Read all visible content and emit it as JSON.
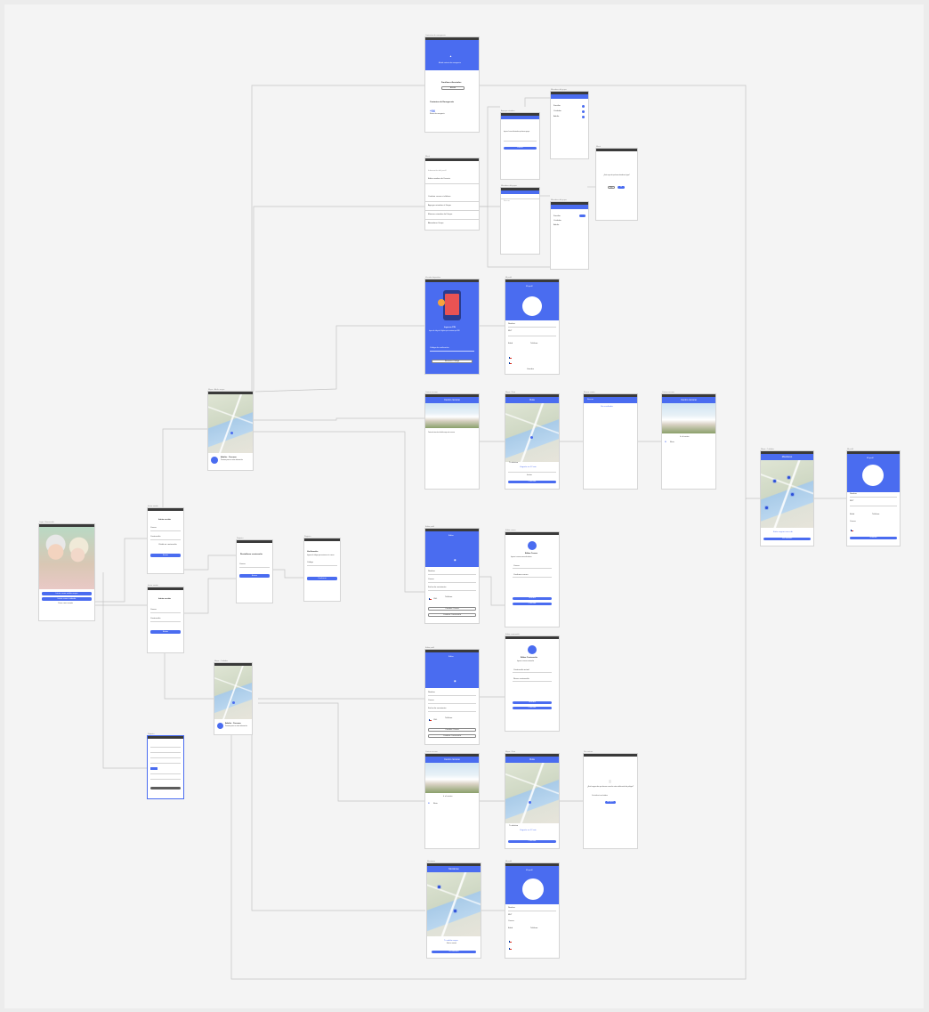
{
  "canvas": {
    "background": "#f4f4f4",
    "accent": "#4a6cf0",
    "wire_color": "#c2c2c2"
  },
  "screen_captions": {
    "welcome": "Login - Bienvenida",
    "login_a": "Iniciar sesión",
    "login_b": "Iniciar sesión",
    "register": "Registro",
    "map_home_a": "Mapa - Adulto mayor",
    "map_home_b": "Mapa - Cuidador",
    "contacts": "Contactos de emergencia",
    "menu": "Menú",
    "pair_device": "Vincular dispositivo",
    "profile_top": "Mi perfil",
    "center_top": "Centro cercano",
    "nav_map": "Mapa - Ruta",
    "search": "Buscar centro",
    "center_b": "Centro cercano",
    "right_map": "Mapa - Cuidador",
    "right_profile": "Mi perfil",
    "profile_edit_a": "Editar perfil",
    "email_screen": "Editar correo",
    "profile_edit_b": "Editar perfil",
    "pass_screen": "Editar contraseña",
    "center_c": "Centro cercano",
    "nav_map_b": "Mapa - Ruta",
    "empty_state": "Sin centros",
    "track_map": "Monitoreo",
    "track_profile": "Mi perfil"
  },
  "welcome": {
    "btn_primary": "Iniciar como adulto mayor",
    "btn_secondary": "Iniciar como cuidador",
    "footer": "Crear una cuenta"
  },
  "login": {
    "title": "Iniciar sesión",
    "field_user": "Correo",
    "field_pass": "Contraseña",
    "forgot": "Olvidé mi contraseña",
    "button": "Entrar"
  },
  "register": {
    "title": "Restablecer contraseña",
    "field": "Correo",
    "button": "Enviar"
  },
  "verify": {
    "title": "Verificación",
    "body": "Ingresa el código que enviamos a tu correo",
    "field": "Código",
    "button": "Confirmar"
  },
  "top_home": {
    "banner": "Añadir contacto de emergencia",
    "section_a": "Familiares Asociados",
    "section_b": "Contactos de Emergencia",
    "add_btn": "Añadir",
    "counter": "+56",
    "counter_sub": "Número de emergencia"
  },
  "menu_screen": {
    "section_a": "Información del perfil",
    "items": [
      "Editar nombre de Usuario",
      "Cambiar correo o teléfono",
      "Agregar miembro al Grupo",
      "Eliminar miembro del Grupo",
      "Abandonar Grupo"
    ]
  },
  "settings_cards": {
    "a_title": "Agregar miembro",
    "a_body": "Ingresa el correo del miembro que deseas agregar",
    "a_button": "Enviar",
    "b_title": "Miembros del grupo",
    "b_items": [
      "Familiar",
      "Cuidador",
      "Adulto"
    ],
    "dialog_title": "¿Estás seguro de que deseas abandonar el grupo?",
    "dialog_yes": "Sí",
    "dialog_no": "No"
  },
  "sms": {
    "title": "Ingresar PIN",
    "body": "Ingresa el código de 4 dígitos que te enviamos por SMS",
    "field": "Código de verificación",
    "button": "Reenviar Código"
  },
  "profile": {
    "header": "Mi perfil",
    "name_label": "Nombre",
    "rut_label": "RUT",
    "age_label": "Edad",
    "phone_label": "Teléfono",
    "email_label": "Correo",
    "button": "Guardar"
  },
  "center": {
    "header": "Centro cercano",
    "caption": "Centro de atención al adulto mayor más cercano",
    "list_item": "Ir al centro",
    "list_item_b": "Ruta"
  },
  "route": {
    "header": "Ruta",
    "card_title": "Tu destino",
    "card_body": "Llegarás en 12 min",
    "btn_a": "Iniciar",
    "btn_b": "Cancelar"
  },
  "search": {
    "placeholder": "Buscar",
    "result": "Sin resultados"
  },
  "email_edit": {
    "title": "Editar Correo",
    "body": "Ingresa tu nuevo correo electrónico",
    "field_a": "Correo",
    "field_b": "Confirmar correo",
    "button_a": "Guardar",
    "button_b": "Cancelar"
  },
  "pass_edit": {
    "title": "Editar Contraseña",
    "body": "Ingresa tu nueva contraseña",
    "field_a": "Contraseña actual",
    "field_b": "Nueva contraseña",
    "button_a": "Guardar",
    "button_b": "Cancelar"
  },
  "edit_profile": {
    "header": "Editar",
    "f1": "Nombre",
    "f2": "Correo",
    "f3": "Fecha de nacimiento",
    "f4": "Teléfono",
    "country": "CHL",
    "btn_a": "Cambiar Correo",
    "btn_b": "Cambiar Contraseña"
  },
  "empty": {
    "title": "¿Está seguro de que desea cancelar esta notificación de peligro?",
    "body": "Se le notificará a sus familiares",
    "button": "Aceptar"
  },
  "map_card": {
    "name": "Adulto - Cercano",
    "body": "Presiona para ver más información"
  },
  "tracking": {
    "card_title": "Tu adulto mayor",
    "card_body": "Está en camino",
    "button": "Ver detalles"
  },
  "right_map_card": {
    "title": "Estás seguro cerca de",
    "button": "Ver detalles"
  }
}
